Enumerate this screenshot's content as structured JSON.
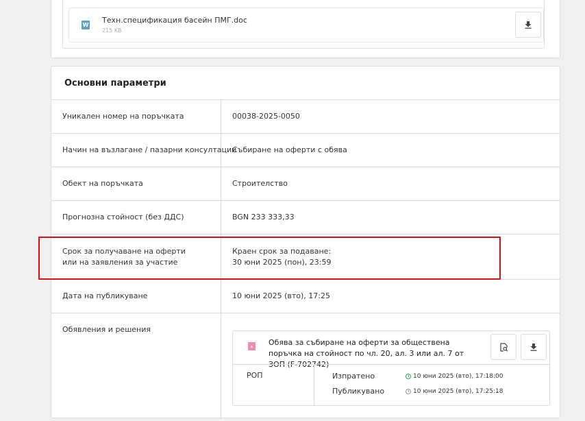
{
  "attachment": {
    "icon": "word-doc-icon",
    "icon_glyph": "W",
    "name": "Техн.спецификация басейн ПМГ.doc",
    "size": "215 KB"
  },
  "section_title": "Основни параметри",
  "params": [
    {
      "label": "Уникален номер на поръчката",
      "value": "00038-2025-0050"
    },
    {
      "label": "Начин на възлагане / пазарни консултации",
      "value": "Събиране на оферти с обява"
    },
    {
      "label": "Обект на поръчката",
      "value": "Строителство"
    },
    {
      "label": "Прогнозна стойност (без ДДС)",
      "value": "BGN 233 333,33"
    },
    {
      "label": "Срок за получаване на оферти или на заявления за участие",
      "value_caption": "Краен срок за подаване:",
      "value": "30 юни 2025 (пон), 23:59"
    },
    {
      "label": "Дата на публикуване",
      "value": "10 юни 2025 (вто), 17:25"
    },
    {
      "label": "Обявления и решения"
    }
  ],
  "notice": {
    "title": "Обява за събиране на оферти за обществена поръчка на стойност по чл. 20, ал. 3 или ал. 7 от ЗОП (F-702742)",
    "source": "РОП",
    "sent_label": "Изпратено",
    "sent_value": "10 юни 2025 (вто), 17:18:00",
    "published_label": "Публикувано",
    "published_value": "10 юни 2025 (вто), 17:25:18"
  },
  "colors": {
    "highlight": "#e01010",
    "doc_icon": "#5ea0c9",
    "pdf_icon": "#f08bb3",
    "sent_status": "#2cab5a"
  }
}
